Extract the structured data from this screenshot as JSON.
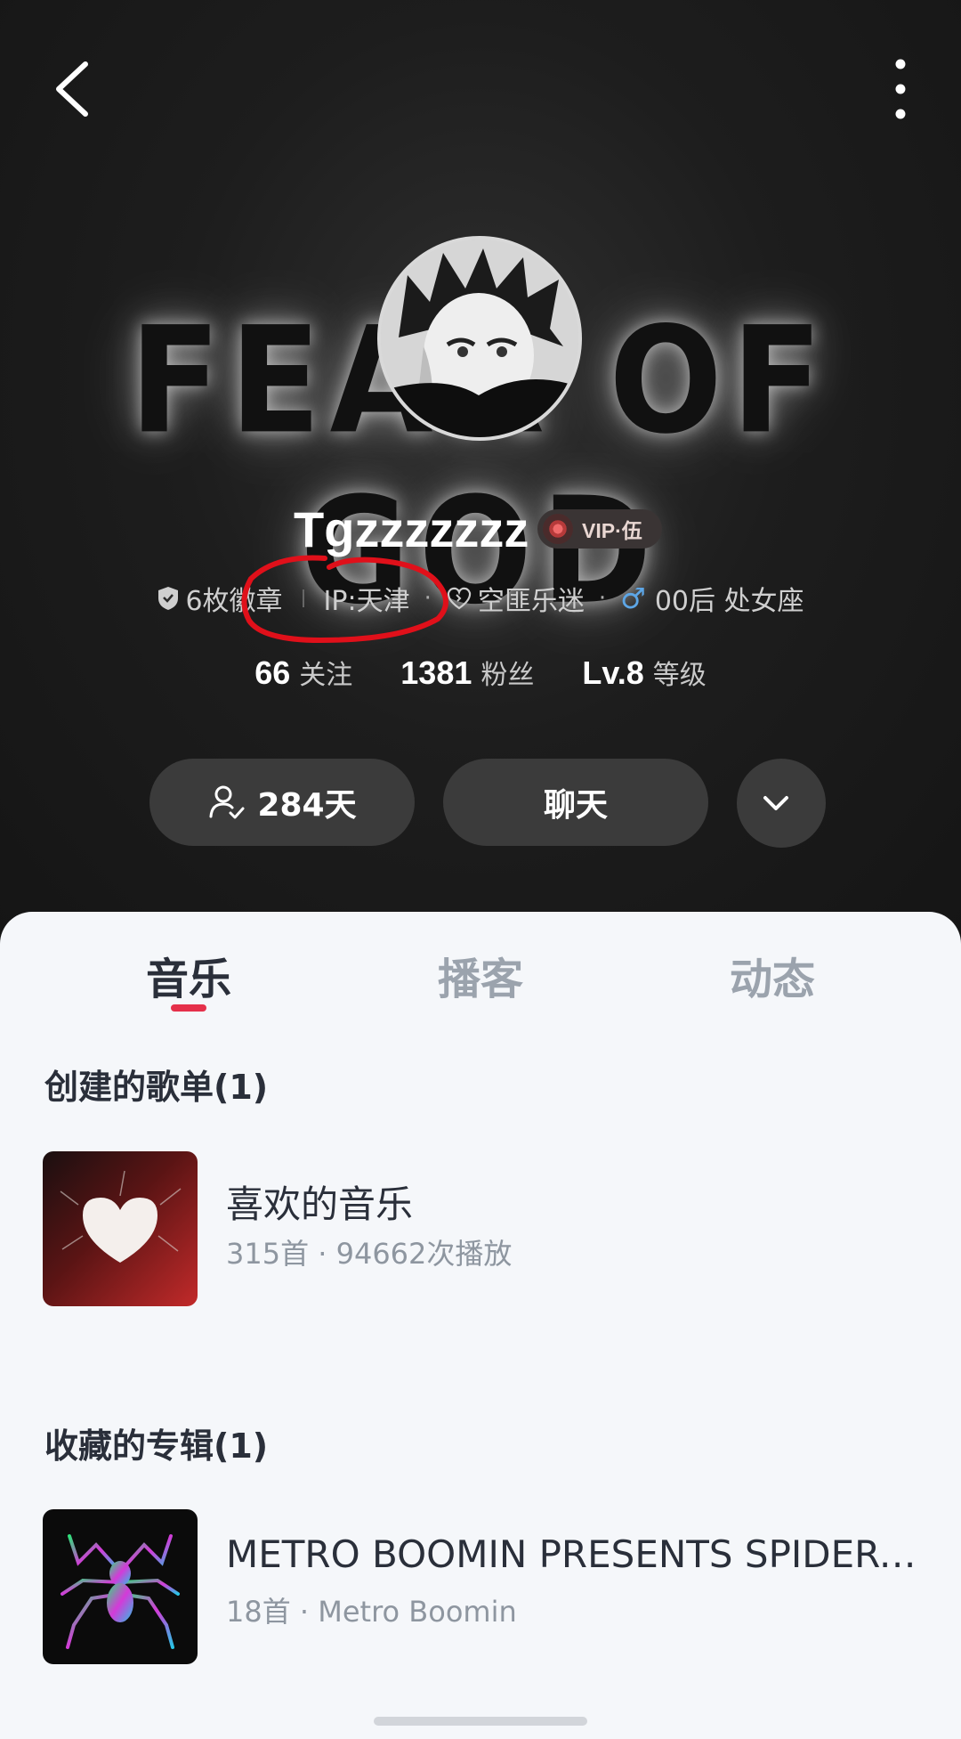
{
  "header": {
    "banner_text": "FEAR OF GOD",
    "username": "Tgzzzzzzz",
    "vip_label": "VIP·伍",
    "info": {
      "badges": "6枚徽章",
      "ip": "IP:天津",
      "fan_type": "空匪乐迷",
      "gender_symbol": "♂",
      "age_sign": "00后 处女座"
    },
    "stats": [
      {
        "num": "66",
        "label": "关注"
      },
      {
        "num": "1381",
        "label": "粉丝"
      },
      {
        "num": "Lv.8",
        "label": "等级"
      }
    ],
    "buttons": {
      "days_label": "284天",
      "chat_label": "聊天"
    }
  },
  "tabs": [
    "音乐",
    "播客",
    "动态"
  ],
  "created_playlists": {
    "title": "创建的歌单(1)",
    "items": [
      {
        "title": "喜欢的音乐",
        "sub": "315首 · 94662次播放"
      }
    ]
  },
  "collected_albums": {
    "title": "收藏的专辑(1)",
    "items": [
      {
        "title": "METRO BOOMIN PRESENTS SPIDER-MAN: ACROSS THE SPIDER-VERSE",
        "sub": "18首 · Metro Boomin"
      }
    ]
  },
  "colors": {
    "accent": "#e5304a",
    "annotation": "#e0101a",
    "gender": "#5da6e6"
  },
  "icons": [
    "back-arrow-icon",
    "more-vertical-icon",
    "badge-shield-icon",
    "fan-heart-icon",
    "user-check-icon",
    "chevron-down-icon",
    "vinyl-icon"
  ]
}
